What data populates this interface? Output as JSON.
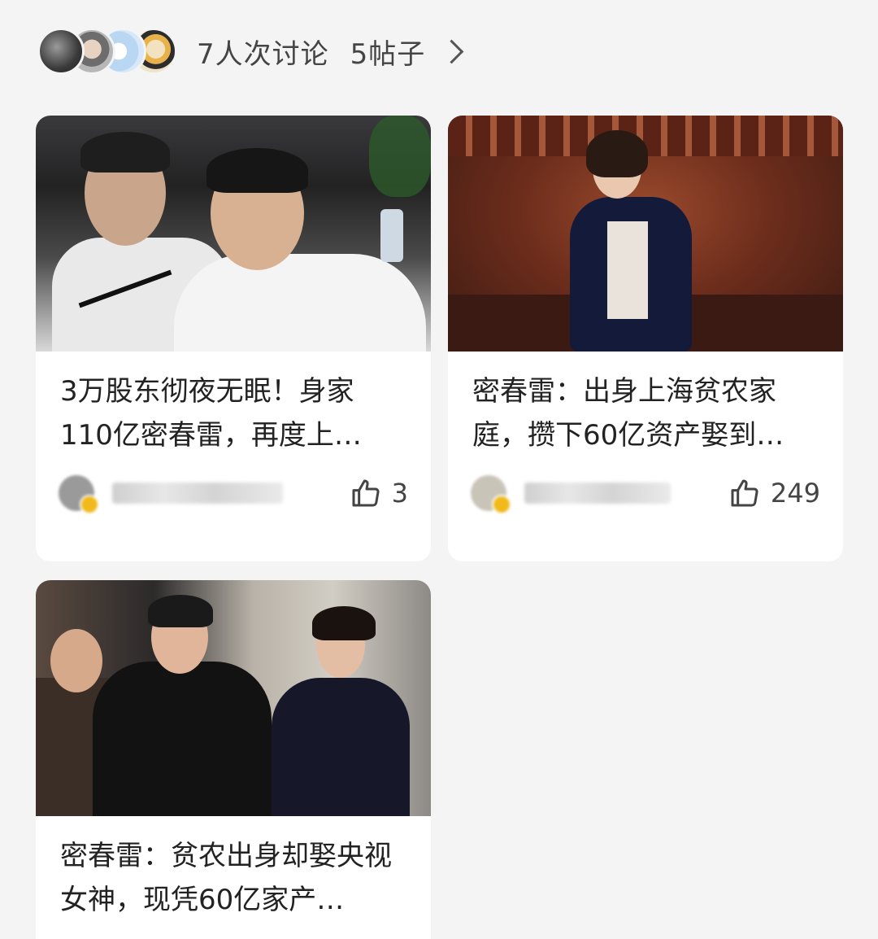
{
  "header": {
    "avatars": [
      "user-avatar-1",
      "user-avatar-2",
      "user-avatar-3",
      "user-avatar-4"
    ],
    "discussions": "7人次讨论",
    "posts": "5帖子"
  },
  "cards": [
    {
      "title": "3万股东彻夜无眠！身家110亿密春雷，再度上…",
      "likes": "3"
    },
    {
      "title": "密春雷：出身上海贫农家庭，攒下60亿资产娶到…",
      "likes": "249"
    },
    {
      "title": "密春雷：贫农出身却娶央视女神，现凭60亿家产…"
    }
  ]
}
